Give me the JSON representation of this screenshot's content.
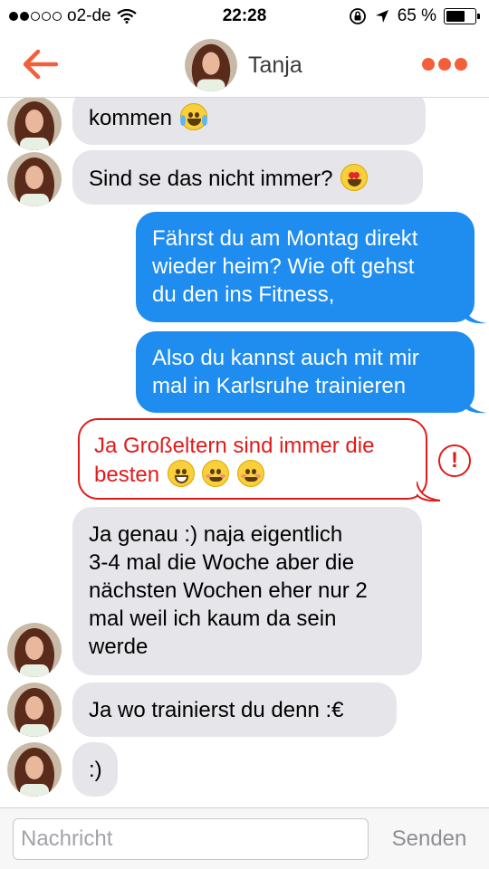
{
  "status_bar": {
    "carrier": "o2-de",
    "time": "22:28",
    "battery_percent_label": "65 %",
    "battery_level": 0.65,
    "signal_bars_filled": 2,
    "signal_bars_total": 5
  },
  "header": {
    "contact_name": "Tanja",
    "back_icon": "back-arrow-icon",
    "more_icon": "more-dots-icon",
    "accent_color": "#f25f3a"
  },
  "messages": [
    {
      "direction": "in",
      "text": "kommen",
      "emoji": "joy-tears"
    },
    {
      "direction": "in",
      "text": "Sind se das nicht immer?",
      "emoji": "heart-eyes"
    },
    {
      "direction": "out",
      "lines": [
        "Fährst du am Montag direkt",
        "wieder heim? Wie oft gehst",
        "du den ins Fitness,"
      ]
    },
    {
      "direction": "out",
      "lines": [
        "Also du kannst auch mit mir",
        "mal in Karlsruhe trainieren"
      ]
    },
    {
      "direction": "failed",
      "lines": [
        "Ja Großeltern sind immer die",
        "besten"
      ],
      "emoji": [
        "grinning",
        "blush",
        "blush"
      ],
      "status_icon": "!"
    },
    {
      "direction": "in",
      "lines": [
        "Ja genau :) naja eigentlich",
        "3-4 mal die Woche aber die",
        "nächsten Wochen eher nur 2",
        "mal weil ich kaum da sein",
        "werde"
      ]
    },
    {
      "direction": "in",
      "text": "Ja wo trainierst du denn :€"
    },
    {
      "direction": "in",
      "text": ":)"
    }
  ],
  "composer": {
    "placeholder": "Nachricht",
    "value": "",
    "send_label": "Senden"
  },
  "colors": {
    "incoming_bubble": "#e5e5ea",
    "outgoing_bubble": "#1f8cf0",
    "failed": "#e21a1a"
  }
}
